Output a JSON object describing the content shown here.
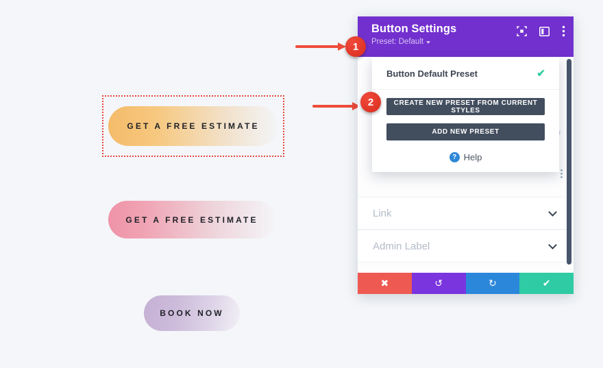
{
  "canvas": {
    "background": "#f4f6f9",
    "preview_buttons": [
      {
        "name": "estimate-orange",
        "label": "GET A FREE ESTIMATE",
        "gradient_from": "#f5bb6a",
        "gradient_to": "#f3f5f8",
        "selected": true
      },
      {
        "name": "estimate-pink",
        "label": "GET A FREE ESTIMATE",
        "gradient_from": "#ef93a8",
        "gradient_to": "#f4f5f8",
        "selected": false
      },
      {
        "name": "book-now",
        "label": "BOOK NOW",
        "gradient_from": "#c5b0d4",
        "gradient_to": "#f1f0f6",
        "selected": false
      }
    ],
    "selection_border_color": "#e8453c"
  },
  "annotations": {
    "arrow_color": "#ee4b3a",
    "marker_color": "#e03425",
    "markers": [
      {
        "number": "1",
        "points_to": "preset-default-dropdown-toggle"
      },
      {
        "number": "2",
        "points_to": "create-new-preset-from-current-styles-button"
      }
    ]
  },
  "panel": {
    "title": "Button Settings",
    "header_color": "#7230ce",
    "preset": {
      "label": "Preset: Default",
      "dropdown": {
        "current_item": "Button Default Preset",
        "current_item_checked": true,
        "check_color": "#2ecda0",
        "actions": [
          "CREATE NEW PRESET FROM CURRENT STYLES",
          "ADD NEW PRESET"
        ],
        "action_color": "#424e5e",
        "help_label": "Help"
      }
    },
    "header_icons": [
      {
        "name": "focus-icon"
      },
      {
        "name": "layout-columns-icon"
      },
      {
        "name": "more-vertical-icon"
      }
    ],
    "ghost_content": {
      "text": "r",
      "dots_icon": "more-vertical-icon"
    },
    "accordion_rows": [
      {
        "label": "Link",
        "expanded": false
      },
      {
        "label": "Admin Label",
        "expanded": false
      }
    ],
    "help_label": "Help",
    "help_badge": "?",
    "help_badge_color": "#2e87d8",
    "footer": [
      {
        "name": "cancel",
        "icon": "close-icon",
        "glyph": "✖",
        "color": "#ee5a52"
      },
      {
        "name": "undo",
        "icon": "undo-icon",
        "glyph": "↺",
        "color": "#7b35de"
      },
      {
        "name": "redo",
        "icon": "redo-icon",
        "glyph": "↻",
        "color": "#2b87da"
      },
      {
        "name": "save",
        "icon": "check-icon",
        "glyph": "✔",
        "color": "#2fcba4"
      }
    ]
  }
}
